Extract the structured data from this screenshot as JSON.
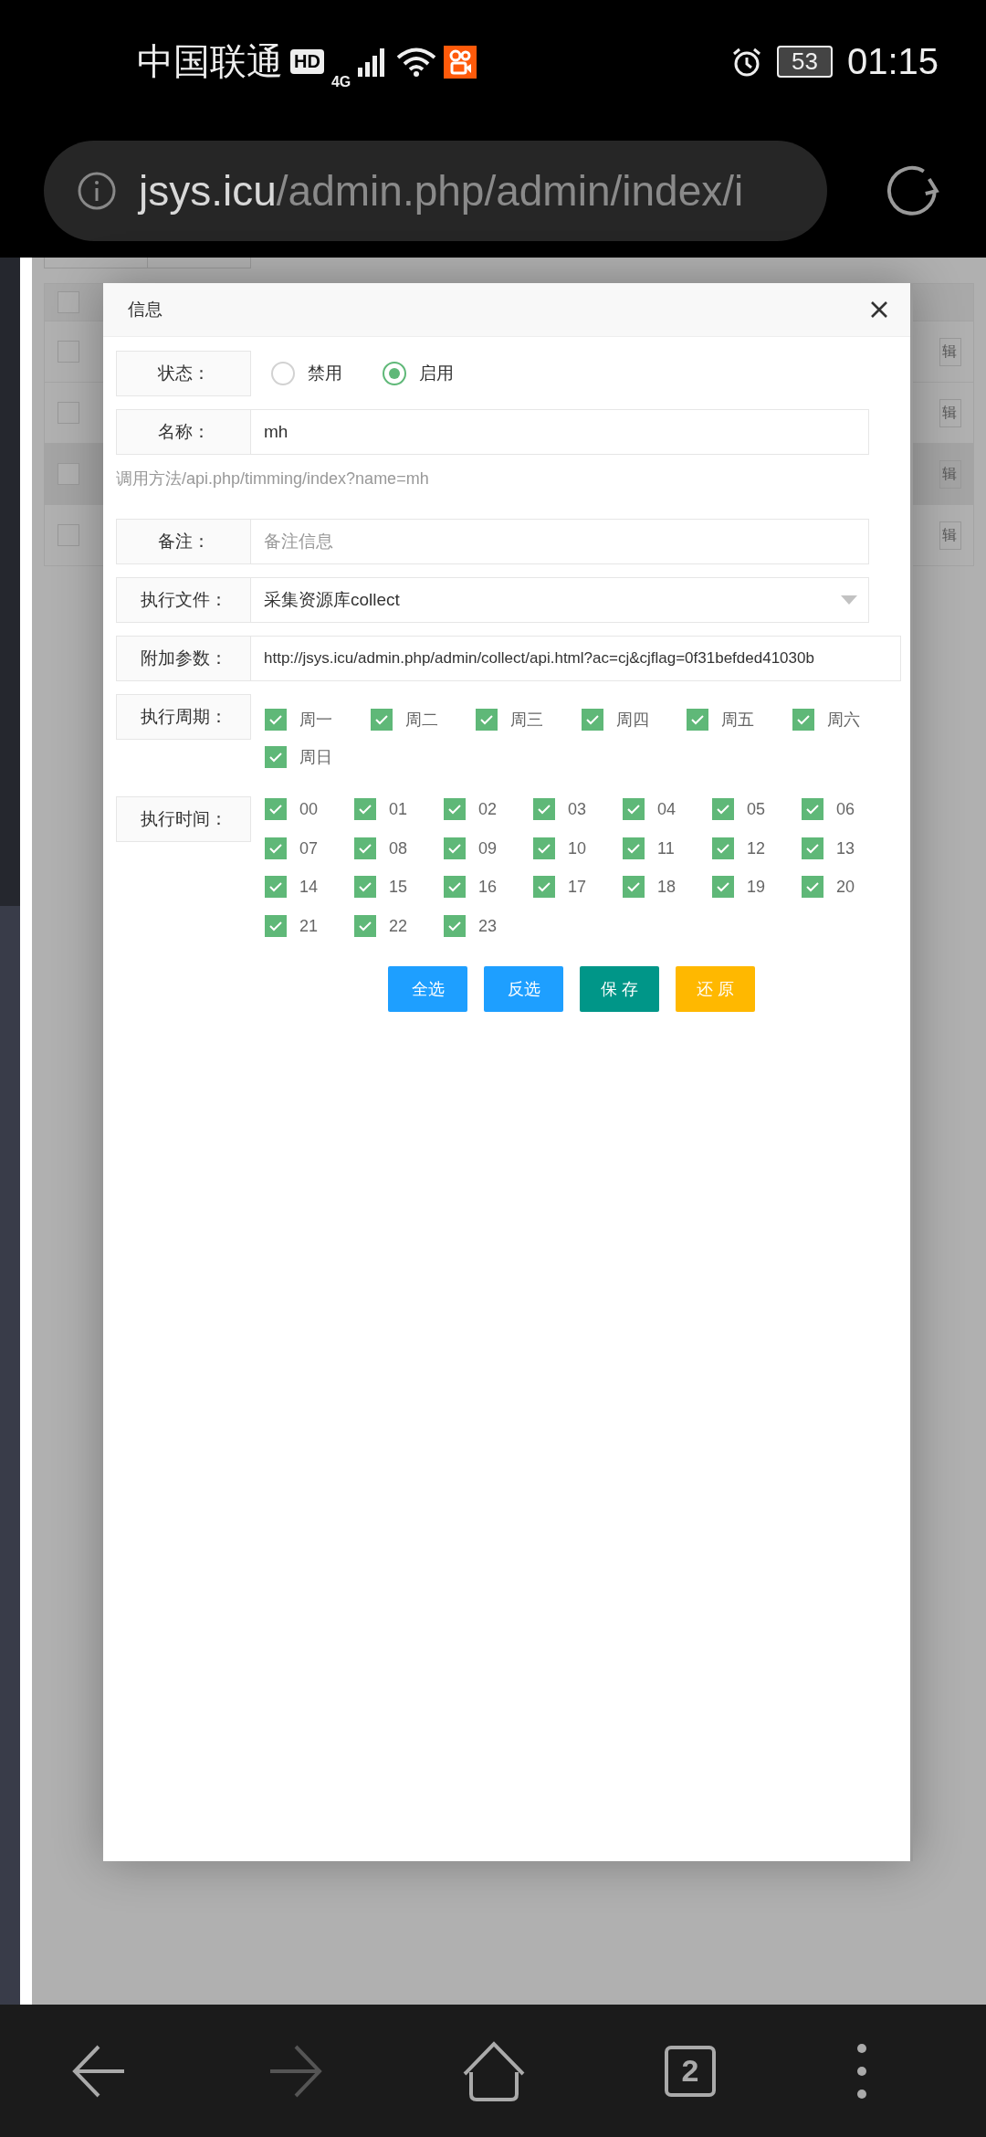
{
  "status_bar": {
    "carrier": "中国联通",
    "hd_badge": "HD",
    "network": "4G",
    "battery": "53",
    "time": "01:15"
  },
  "address_bar": {
    "url_host": "jsys.icu",
    "url_path": "/admin.php/admin/index/i"
  },
  "background_table": {
    "header_checked": false,
    "rows": [
      {
        "checked": false,
        "highlighted": false,
        "button_fragment": "辑"
      },
      {
        "checked": false,
        "highlighted": false,
        "button_fragment": "辑"
      },
      {
        "checked": false,
        "highlighted": true,
        "button_fragment": "辑"
      },
      {
        "checked": false,
        "highlighted": false,
        "button_fragment": "辑"
      }
    ]
  },
  "dialog": {
    "title": "信息",
    "fields": [
      {
        "kind": "radio",
        "label": "状态：",
        "options": [
          {
            "label": "禁用",
            "selected": false
          },
          {
            "label": "启用",
            "selected": true
          }
        ]
      },
      {
        "kind": "text",
        "label": "名称：",
        "value": "mh"
      },
      {
        "kind": "hint",
        "text": "调用方法/api.php/timming/index?name=mh"
      },
      {
        "kind": "text",
        "label": "备注：",
        "placeholder": "备注信息"
      },
      {
        "kind": "select",
        "label": "执行文件：",
        "value": "采集资源库collect"
      },
      {
        "kind": "wide_text",
        "label": "附加参数：",
        "value": "http://jsys.icu/admin.php/admin/collect/api.html?ac=cj&cjflag=0f31befded41030b"
      },
      {
        "kind": "days",
        "label": "执行周期：",
        "options": [
          {
            "label": "周一",
            "checked": true
          },
          {
            "label": "周二",
            "checked": true
          },
          {
            "label": "周三",
            "checked": true
          },
          {
            "label": "周四",
            "checked": true
          },
          {
            "label": "周五",
            "checked": true
          },
          {
            "label": "周六",
            "checked": true
          },
          {
            "label": "周日",
            "checked": true
          }
        ]
      },
      {
        "kind": "hours",
        "label": "执行时间：",
        "options": [
          {
            "label": "00",
            "checked": true
          },
          {
            "label": "01",
            "checked": true
          },
          {
            "label": "02",
            "checked": true
          },
          {
            "label": "03",
            "checked": true
          },
          {
            "label": "04",
            "checked": true
          },
          {
            "label": "05",
            "checked": true
          },
          {
            "label": "06",
            "checked": true
          },
          {
            "label": "07",
            "checked": true
          },
          {
            "label": "08",
            "checked": true
          },
          {
            "label": "09",
            "checked": true
          },
          {
            "label": "10",
            "checked": true
          },
          {
            "label": "11",
            "checked": true
          },
          {
            "label": "12",
            "checked": true
          },
          {
            "label": "13",
            "checked": true
          },
          {
            "label": "14",
            "checked": true
          },
          {
            "label": "15",
            "checked": true
          },
          {
            "label": "16",
            "checked": true
          },
          {
            "label": "17",
            "checked": true
          },
          {
            "label": "18",
            "checked": true
          },
          {
            "label": "19",
            "checked": true
          },
          {
            "label": "20",
            "checked": true
          },
          {
            "label": "21",
            "checked": true
          },
          {
            "label": "22",
            "checked": true
          },
          {
            "label": "23",
            "checked": true
          }
        ]
      }
    ],
    "buttons": [
      {
        "label": "全选",
        "kind": "primary"
      },
      {
        "label": "反选",
        "kind": "primary"
      },
      {
        "label": "保 存",
        "kind": "teal"
      },
      {
        "label": "还 原",
        "kind": "warm"
      }
    ]
  },
  "nav_bar": {
    "forward_disabled": true,
    "tab_count": "2"
  }
}
